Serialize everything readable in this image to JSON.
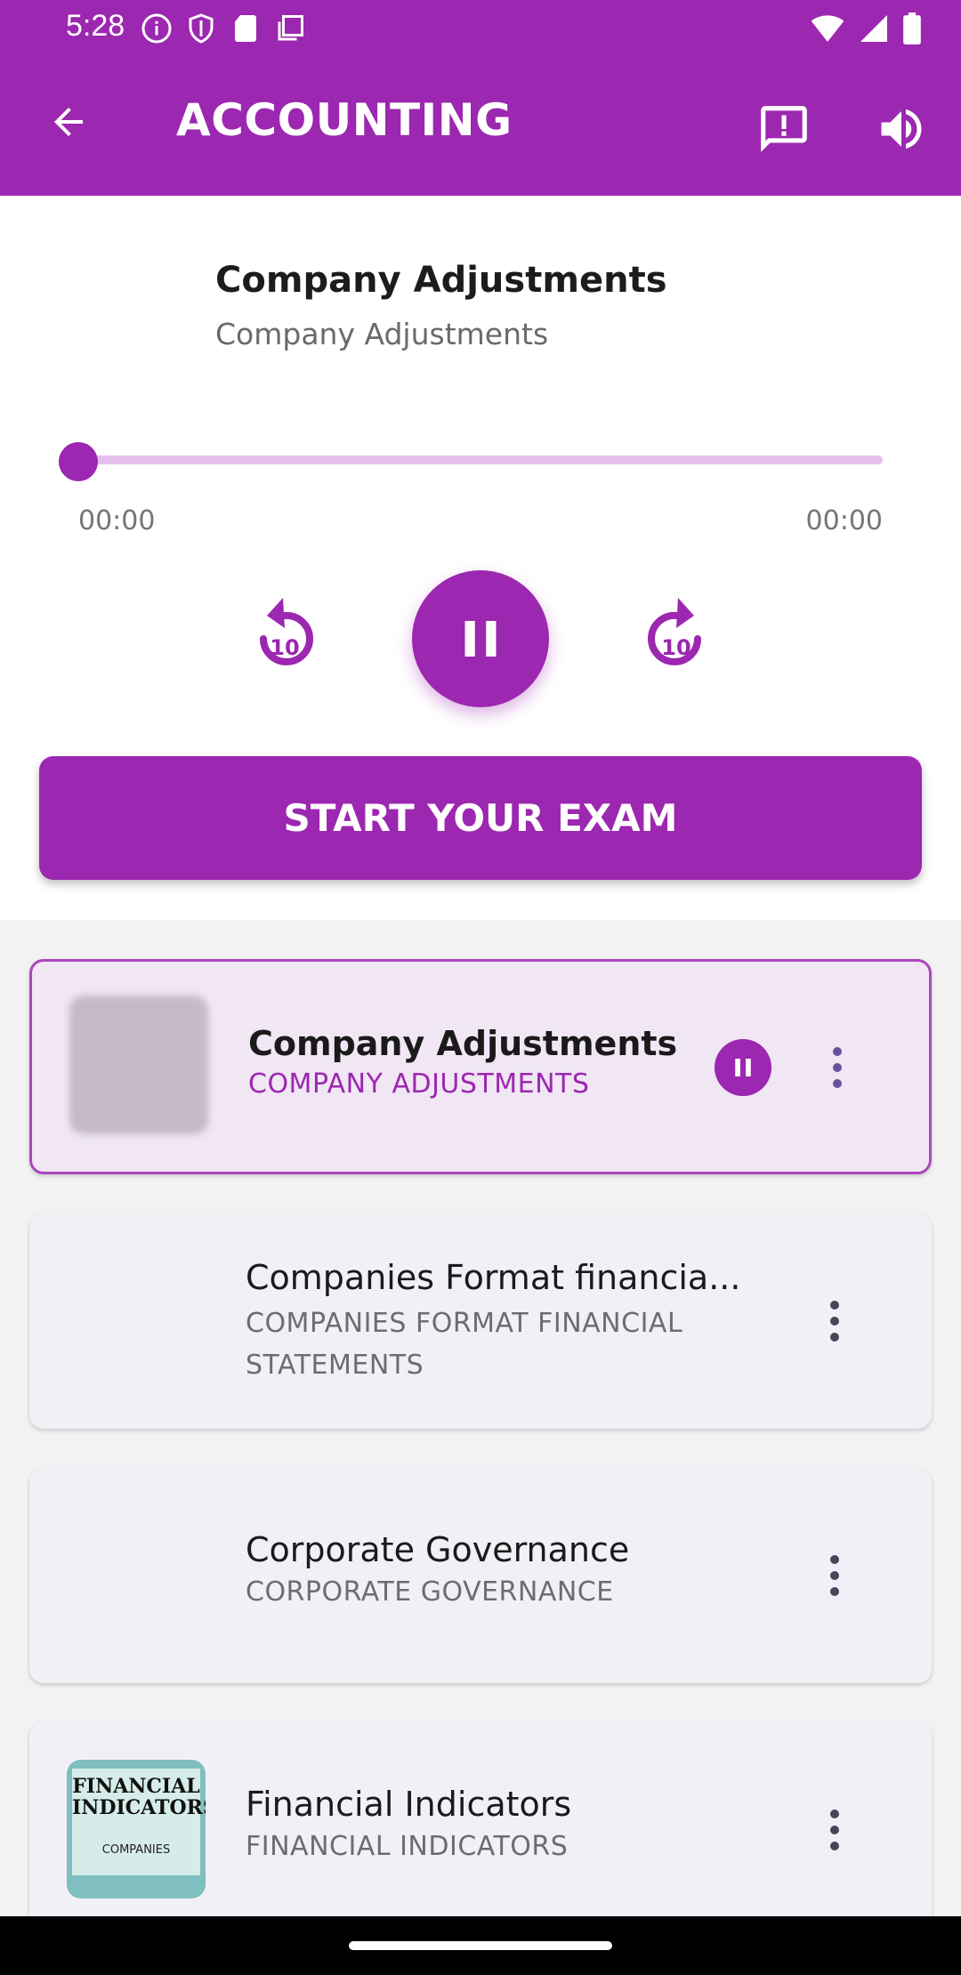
{
  "status": {
    "time": "5:28"
  },
  "appbar": {
    "title": "ACCOUNTING"
  },
  "player": {
    "title": "Company Adjustments",
    "subtitle": "Company Adjustments",
    "time_start": "00:00",
    "time_end": "00:00",
    "progress": 0,
    "rewind_label": "10",
    "forward_label": "10"
  },
  "exam_button": {
    "label": "START YOUR EXAM"
  },
  "list": [
    {
      "title": "Company Adjustments",
      "subtitle": "COMPANY ADJUSTMENTS",
      "active": true
    },
    {
      "title": "Companies Format financia...",
      "subtitle": "COMPANIES FORMAT FINANCIAL STATEMENTS",
      "active": false
    },
    {
      "title": "Corporate Governance",
      "subtitle": "CORPORATE GOVERNANCE",
      "active": false
    },
    {
      "title": "Financial Indicators",
      "subtitle": "FINANCIAL INDICATORS",
      "active": false,
      "thumb_text_1": "FINANCIAL",
      "thumb_text_2": "INDICATORS",
      "thumb_text_3": "COMPANIES"
    }
  ],
  "colors": {
    "accent": "#9c27b0",
    "accent_light": "#e6c0ec",
    "card_bg": "#f3eff7"
  }
}
